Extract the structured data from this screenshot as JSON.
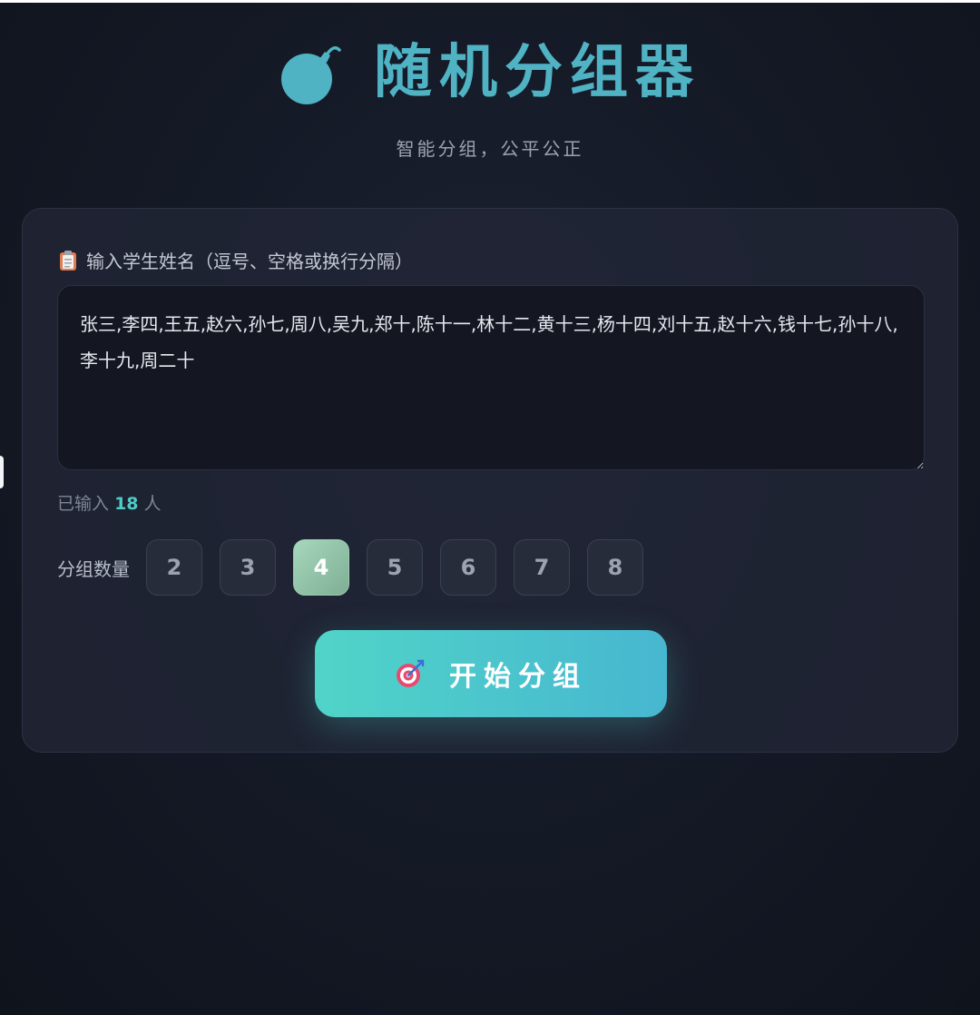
{
  "header": {
    "title": "随机分组器",
    "subtitle": "智能分组，公平公正",
    "title_icon": "bomb-icon"
  },
  "input": {
    "label_icon": "clipboard-icon",
    "label": "输入学生姓名（逗号、空格或换行分隔）",
    "value": "张三,李四,王五,赵六,孙七,周八,吴九,郑十,陈十一,林十二,黄十三,杨十四,刘十五,赵十六,钱十七,孙十八,李十九,周二十"
  },
  "count": {
    "prefix": "已输入",
    "number": "18",
    "suffix": "人"
  },
  "groups": {
    "label": "分组数量",
    "options": [
      "2",
      "3",
      "4",
      "5",
      "6",
      "7",
      "8"
    ],
    "selected": "4"
  },
  "start_button": {
    "icon": "target-icon",
    "label": "开始分组"
  },
  "colors": {
    "accent": "#4ecdc4",
    "title": "#4fb3c4",
    "selected_group": "#a6d8be",
    "background": "#151a27"
  }
}
